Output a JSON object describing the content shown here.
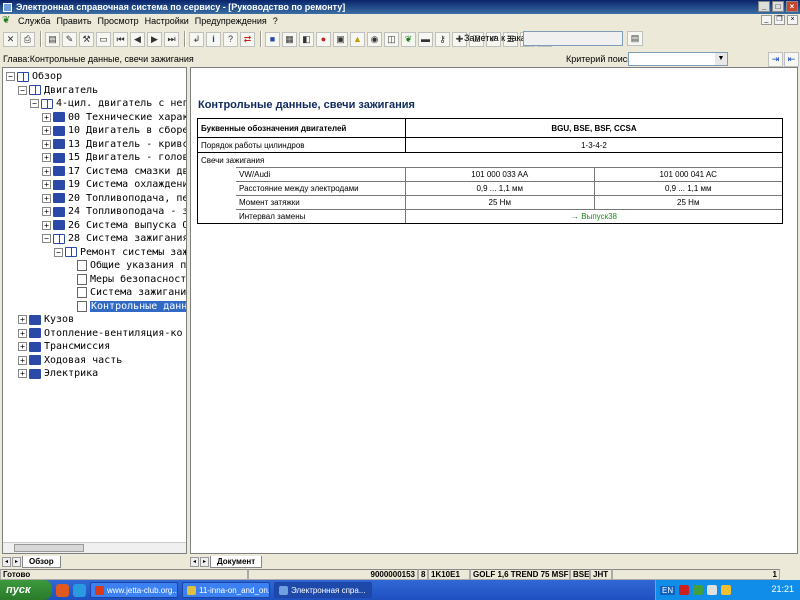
{
  "window": {
    "title": "Электронная справочная система по сервису - [Руководство по ремонту]"
  },
  "menu": {
    "items": [
      "Служба",
      "Править",
      "Просмотр",
      "Настройки",
      "Предупреждения",
      "?"
    ]
  },
  "toolbar": {
    "order_note_label": "Заметка к заказу:",
    "order_note_value": ""
  },
  "chapterbar": {
    "chapter": "Глава:Контрольные данные, свечи зажигания",
    "search_label": "Критерий поиска:",
    "search_value": ""
  },
  "tree": {
    "items": [
      {
        "label": "Обзор",
        "toggle": "−",
        "icon": "open-book-icon"
      },
      {
        "label": "Двигатель",
        "toggle": "−",
        "icon": "open-book-icon"
      },
      {
        "label": "4-цил. двигатель с нег",
        "toggle": "−",
        "icon": "open-book-icon"
      },
      {
        "label": "00 Технические харак",
        "toggle": "+",
        "icon": "book-icon"
      },
      {
        "label": "10 Двигатель в сборе",
        "toggle": "+",
        "icon": "book-icon"
      },
      {
        "label": "13 Двигатель - кривс",
        "toggle": "+",
        "icon": "book-icon"
      },
      {
        "label": "15 Двигатель - голов",
        "toggle": "+",
        "icon": "book-icon"
      },
      {
        "label": "17 Система смазки дв",
        "toggle": "+",
        "icon": "book-icon"
      },
      {
        "label": "19 Система охлаждени",
        "toggle": "+",
        "icon": "book-icon"
      },
      {
        "label": "20 Топливоподача, пе",
        "toggle": "+",
        "icon": "book-icon"
      },
      {
        "label": "24 Топливоподача - з",
        "toggle": "+",
        "icon": "book-icon"
      },
      {
        "label": "26 Система выпуска О",
        "toggle": "+",
        "icon": "book-icon"
      },
      {
        "label": "28 Система зажигания",
        "toggle": "−",
        "icon": "open-book-icon"
      },
      {
        "label": "Ремонт системы заж",
        "toggle": "−",
        "icon": "open-book-icon"
      },
      {
        "label": "Общие указания п",
        "toggle": "",
        "icon": "document-icon"
      },
      {
        "label": "Меры безопасност",
        "toggle": "",
        "icon": "document-icon"
      },
      {
        "label": "Система зажигани",
        "toggle": "",
        "icon": "document-icon"
      },
      {
        "label": "Контрольные данн",
        "toggle": "",
        "icon": "document-icon",
        "selected": true
      },
      {
        "label": "Кузов",
        "toggle": "+",
        "icon": "book-icon"
      },
      {
        "label": "Отопление-вентиляция-ко",
        "toggle": "+",
        "icon": "book-icon"
      },
      {
        "label": "Трансмиссия",
        "toggle": "+",
        "icon": "book-icon"
      },
      {
        "label": "Ходовая часть",
        "toggle": "+",
        "icon": "book-icon"
      },
      {
        "label": "Электрика",
        "toggle": "+",
        "icon": "book-icon"
      }
    ]
  },
  "tabs": {
    "left": "Обзор",
    "right": "Документ"
  },
  "document": {
    "title": "Контрольные данные, свечи зажигания",
    "engine_codes_label": "Буквенные обозначения двигателей",
    "engine_codes_value": "BGU, BSE, BSF, CCSA",
    "firing_order_label": "Порядок работы цилиндров",
    "firing_order_value": "1-3-4-2",
    "spark_plugs_label": "Свечи зажигания",
    "vw_audi_label": "VW/Audi",
    "part_1": "101 000 033 AA",
    "part_2": "101 000 041 AC",
    "gap_label": "Расстояние между электродами",
    "gap_1": "0,9 ... 1,1 мм",
    "gap_2": "0,9 ... 1,1 мм",
    "torque_label": "Момент затяжки",
    "torque_1": "25 Нм",
    "torque_2": "25 Нм",
    "interval_label": "Интервал замены",
    "interval_value": "→ Выпуск38"
  },
  "statusbar": {
    "state": "Готово",
    "number": "9000000153",
    "digit": "8",
    "code": "1K10E1",
    "model": "GOLF 1,6 TREND 75 MSF",
    "engine": "BSE",
    "gearbox": "JHT",
    "page": "1"
  },
  "taskbar": {
    "start": "пуск",
    "tasks": [
      "www.jetta-club.org...",
      "11-inna-on_and_on...",
      "Электронная спра..."
    ],
    "language": "EN",
    "clock": "21:21"
  }
}
